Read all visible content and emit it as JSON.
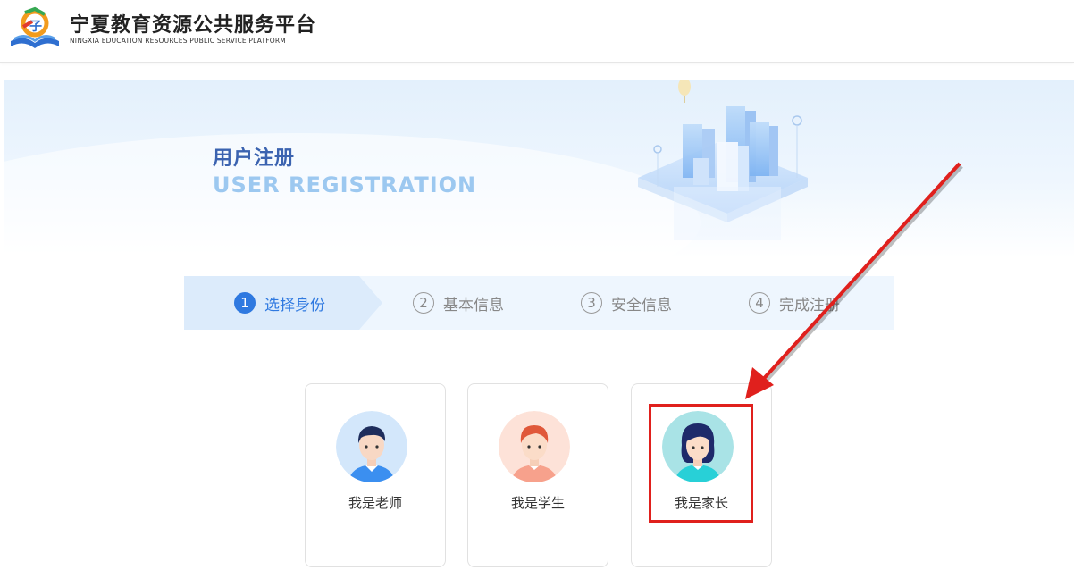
{
  "header": {
    "title": "宁夏教育资源公共服务平台",
    "subtitle": "NINGXIA EDUCATION RESOURCES PUBLIC SERVICE PLATFORM",
    "logo_icon": "ningxia-education-logo"
  },
  "banner": {
    "title_cn": "用户注册",
    "title_en": "USER REGISTRATION"
  },
  "steps": [
    {
      "num": "1",
      "label": "选择身份",
      "active": true
    },
    {
      "num": "2",
      "label": "基本信息",
      "active": false
    },
    {
      "num": "3",
      "label": "安全信息",
      "active": false
    },
    {
      "num": "4",
      "label": "完成注册",
      "active": false
    }
  ],
  "identity_cards": [
    {
      "label": "我是老师",
      "avatar": "teacher-avatar-icon"
    },
    {
      "label": "我是学生",
      "avatar": "student-avatar-icon"
    },
    {
      "label": "我是家长",
      "avatar": "parent-avatar-icon"
    }
  ],
  "annotation": {
    "highlight_color": "#e0201d",
    "target": "我是家长"
  },
  "colors": {
    "accent": "#2f79e0",
    "banner_title": "#3b63b0",
    "banner_en": "#9cc8f0",
    "step_bg": "#eef6fe"
  }
}
